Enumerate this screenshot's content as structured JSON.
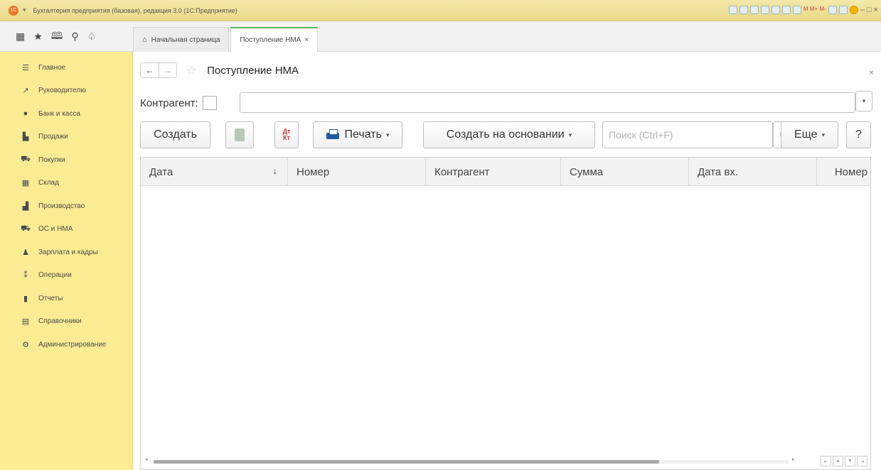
{
  "titlebar": {
    "title": "Бухгалтерия предприятия (базовая), редакция 3.0  (1С:Предприятие)",
    "logo": "1С",
    "menu_glyph": "▾",
    "right_text": "M  M+  M-",
    "window_controls": "– □ ×"
  },
  "nav_icons": [
    {
      "name": "apps-grid-icon",
      "glyph": "▦"
    },
    {
      "name": "favorites-icon",
      "glyph": "★"
    },
    {
      "name": "history-icon",
      "glyph": "🕮"
    },
    {
      "name": "search-icon",
      "glyph": "⚲"
    },
    {
      "name": "notifications-icon",
      "glyph": "♤"
    }
  ],
  "tabs": {
    "home": {
      "label": "Начальная страница",
      "icon": "home-icon"
    },
    "active": {
      "label": "Поступление НМА",
      "close": "×"
    }
  },
  "sidebar": {
    "items": [
      {
        "label": "Главное",
        "icon": "☰"
      },
      {
        "label": "Руководителю",
        "icon": "↗"
      },
      {
        "label": "Банк и касса",
        "icon": "●"
      },
      {
        "label": "Продажи",
        "icon": "▙"
      },
      {
        "label": "Покупки",
        "icon": "⛟"
      },
      {
        "label": "Склад",
        "icon": "▦"
      },
      {
        "label": "Производство",
        "icon": "▟"
      },
      {
        "label": "ОС и НМА",
        "icon": "⛟"
      },
      {
        "label": "Зарплата и кадры",
        "icon": "♟"
      },
      {
        "label": "Операции",
        "icon": "⁑"
      },
      {
        "label": "Отчеты",
        "icon": "▮"
      },
      {
        "label": "Справочники",
        "icon": "▤"
      },
      {
        "label": "Администрирование",
        "icon": "⚙"
      }
    ]
  },
  "header": {
    "back": "←",
    "forward": "→",
    "star": "☆",
    "title": "Поступление НМА",
    "close": "×"
  },
  "filter": {
    "label": "Контрагент:",
    "value": "",
    "dropdown": "▾"
  },
  "toolbar": {
    "create": "Создать",
    "dtkt_top": "Дт",
    "dtkt_bottom": "Кт",
    "print": "Печать",
    "create_based_on": "Создать на основании",
    "search_placeholder": "Поиск (Ctrl+F)",
    "search_clear": "×",
    "more": "Еще",
    "help": "?",
    "arrow": "▾"
  },
  "table": {
    "columns": [
      "Дата",
      "Номер",
      "Контрагент",
      "Сумма",
      "Дата вх.",
      "Номер"
    ],
    "sort_glyph": "↓",
    "rows": [],
    "pager": [
      "⇤",
      "▲",
      "▼",
      "⇥"
    ],
    "scroll_left": "◂",
    "scroll_right": "▸"
  }
}
